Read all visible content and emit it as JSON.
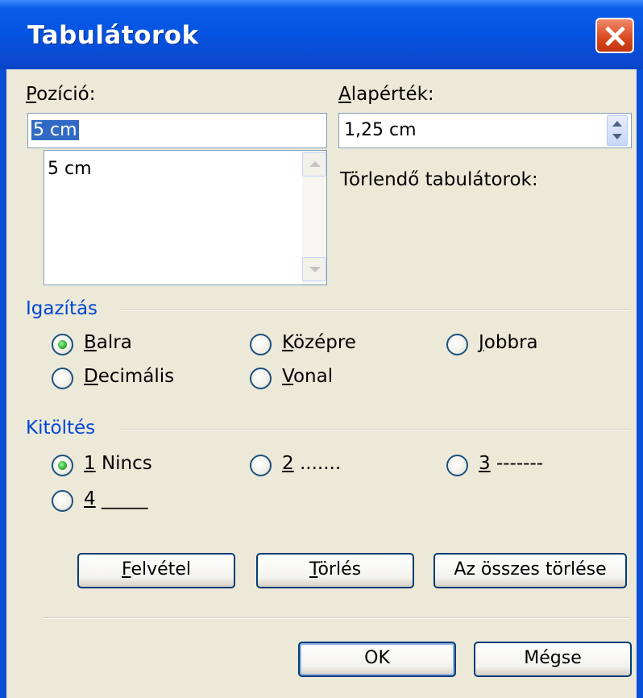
{
  "dialog": {
    "title": "Tabulátorok"
  },
  "position": {
    "label": "Pozíció:",
    "value": "5 cm",
    "list": [
      "5 cm"
    ]
  },
  "default_tab": {
    "label": "Alapérték:",
    "value": "1,25 cm"
  },
  "to_clear_label": "Törlendő tabulátorok:",
  "alignment": {
    "legend": "Igazítás",
    "options": [
      {
        "label": "Balra",
        "selected": true
      },
      {
        "label": "Középre",
        "selected": false
      },
      {
        "label": "Jobbra",
        "selected": false
      },
      {
        "label": "Decimális",
        "selected": false
      },
      {
        "label": "Vonal",
        "selected": false
      }
    ]
  },
  "leader": {
    "legend": "Kitöltés",
    "options": [
      {
        "label": "1 Nincs",
        "selected": true
      },
      {
        "label": "2 .......",
        "selected": false
      },
      {
        "label": "3 -------",
        "selected": false
      },
      {
        "label": "4 _____",
        "selected": false
      }
    ]
  },
  "buttons": {
    "set": "Felvétel",
    "clear": "Törlés",
    "clear_all": "Az összes törlése",
    "ok": "OK",
    "cancel": "Mégse"
  },
  "colors": {
    "titlebar": "#0554e3",
    "dialog_bg": "#ece9d8",
    "group_legend": "#0046d5",
    "selection": "#316ac5"
  }
}
